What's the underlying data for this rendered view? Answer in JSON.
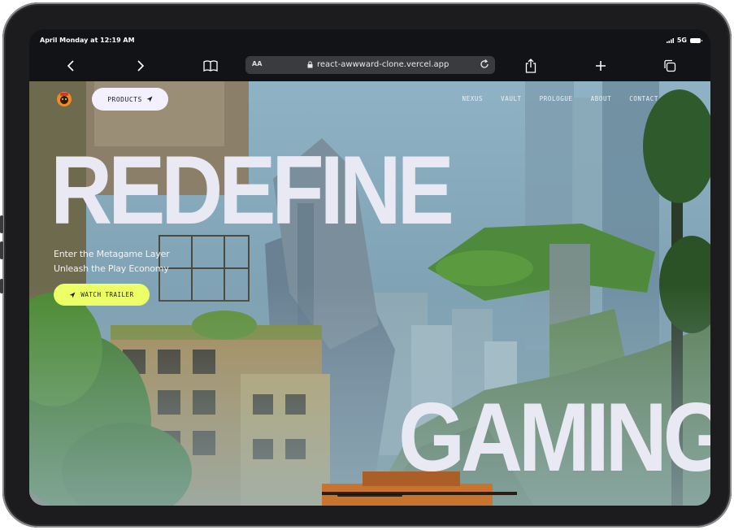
{
  "status": {
    "time": "April Monday at 12:19 AM",
    "network": "5G"
  },
  "browser": {
    "text_size": "AA",
    "url": "react-awwward-clone.vercel.app"
  },
  "site": {
    "products_label": "PRODUCTS",
    "nav": [
      "NEXUS",
      "VAULT",
      "PROLOGUE",
      "ABOUT",
      "CONTACT"
    ],
    "hero_word_top": "REDEFINE",
    "hero_word_bottom": "GAMING",
    "tagline_1": "Enter the Metagame Layer",
    "tagline_2": "Unleash the Play Economy",
    "cta_label": "WATCH TRAILER"
  },
  "colors": {
    "cta": "#edff66",
    "pill": "#f3f1ff",
    "hero_text": "#e9e9f4",
    "frame": "#1c1c1e"
  },
  "icons": [
    "back-chevron-icon",
    "forward-chevron-icon",
    "book-icon",
    "lock-icon",
    "reload-icon",
    "share-icon",
    "plus-icon",
    "tabs-icon",
    "send-arrow-icon",
    "signal-icon",
    "battery-icon"
  ]
}
